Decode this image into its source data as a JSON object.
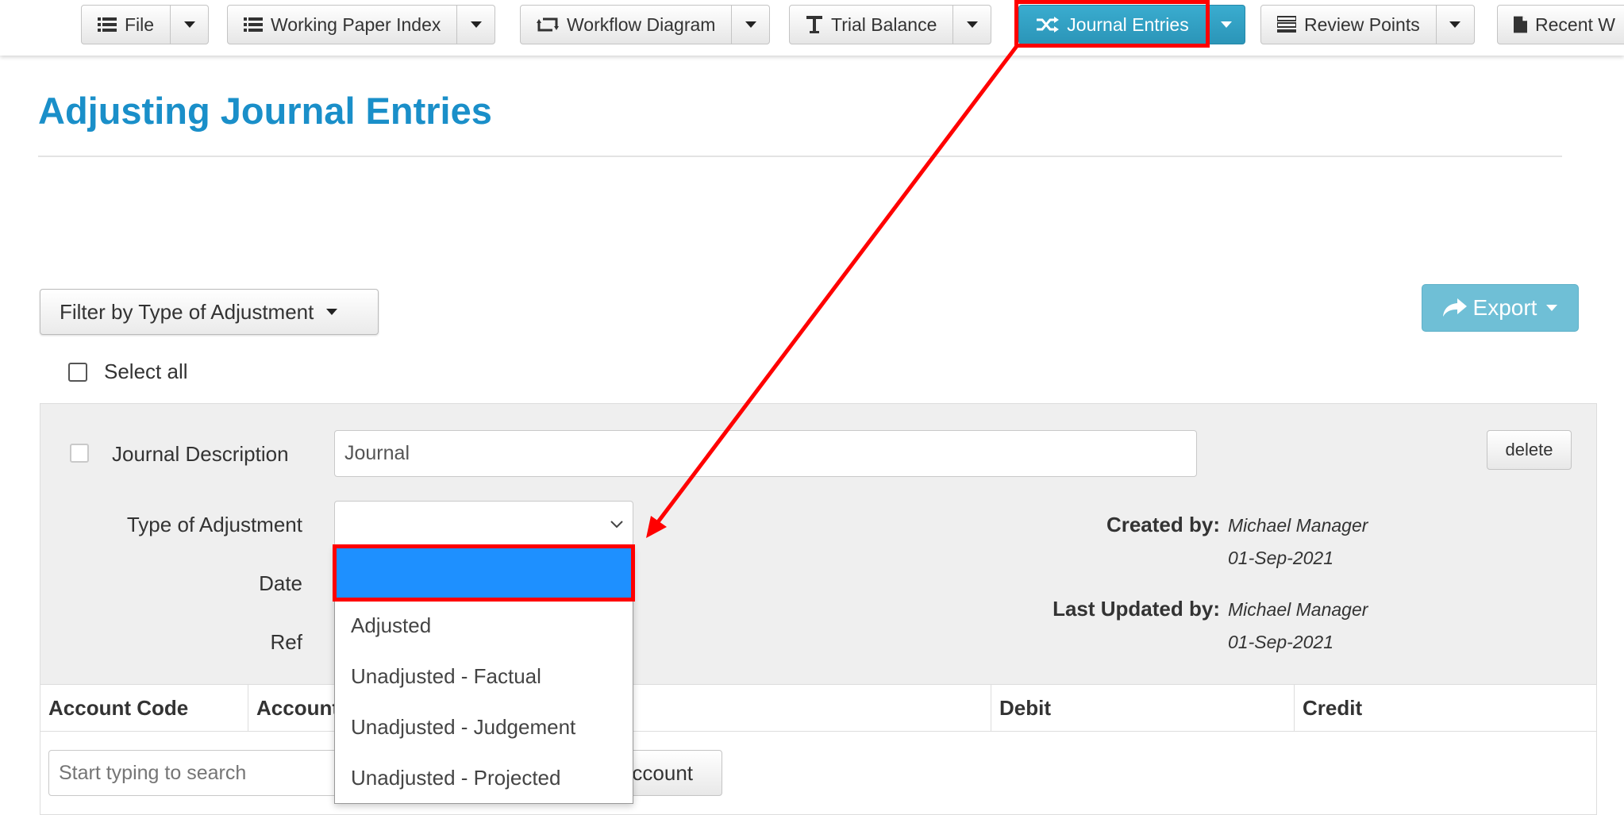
{
  "toolbar": {
    "buttons": [
      {
        "label": "File",
        "icon": "list-icon"
      },
      {
        "label": "Working Paper Index",
        "icon": "list-icon"
      },
      {
        "label": "Workflow Diagram",
        "icon": "retweet-icon"
      },
      {
        "label": "Trial Balance",
        "icon": "text-t-icon"
      },
      {
        "label": "Journal Entries",
        "icon": "shuffle-icon",
        "active": true
      },
      {
        "label": "Review Points",
        "icon": "tasks-icon"
      },
      {
        "label": "Recent W",
        "icon": "file-icon"
      }
    ]
  },
  "page": {
    "title": "Adjusting Journal Entries"
  },
  "filter": {
    "label": "Filter by Type of Adjustment"
  },
  "export": {
    "label": "Export"
  },
  "select_all": {
    "label": "Select all"
  },
  "journal": {
    "description_label": "Journal Description",
    "description_value": "Journal",
    "type_label": "Type of Adjustment",
    "type_value": "",
    "date_label": "Date",
    "ref_label": "Ref",
    "delete_label": "delete",
    "created_by_label": "Created by:",
    "created_by_name": "Michael Manager",
    "created_date": "01-Sep-2021",
    "updated_by_label": "Last Updated by:",
    "updated_by_name": "Michael Manager",
    "updated_date": "01-Sep-2021"
  },
  "table": {
    "columns": [
      "Account Code",
      "Account",
      "Debit",
      "Credit"
    ],
    "search_placeholder": "Start typing to search",
    "add_account_label": "Add Account"
  },
  "dropdown": {
    "options": [
      "",
      "Adjusted",
      "Unadjusted - Factual",
      "Unadjusted - Judgement",
      "Unadjusted - Projected"
    ],
    "highlighted_index": 0
  },
  "colors": {
    "accent": "#1a8fc9",
    "active_button": "#2b95b8",
    "annotation": "#ff0000",
    "selection": "#1e90ff"
  }
}
